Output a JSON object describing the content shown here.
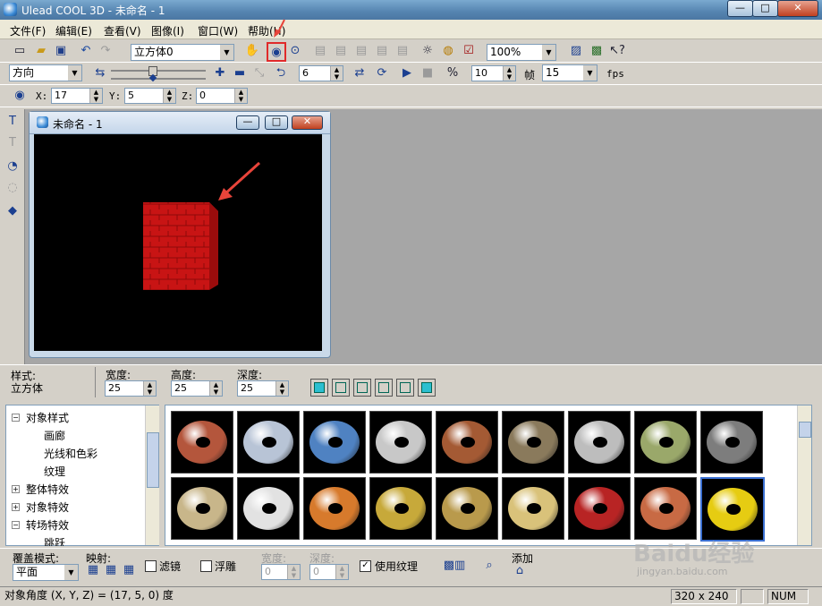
{
  "window": {
    "title": "Ulead COOL 3D - 未命名 - 1",
    "min": "—",
    "max": "□",
    "close": "✕"
  },
  "menu": [
    "文件(F)",
    "编辑(E)",
    "查看(V)",
    "图像(I)",
    "窗口(W)",
    "帮助(H)"
  ],
  "toolbar1": {
    "object_select": "立方体0",
    "zoom": "100%"
  },
  "toolbar2": {
    "motion": "方向",
    "frame_val": "6",
    "speed": "10",
    "frames_label": "帧",
    "frames": "15",
    "fps_label": "fps"
  },
  "coords": {
    "x_label": "X:",
    "x": "17",
    "y_label": "Y:",
    "y": "5",
    "z_label": "Z:",
    "z": "0"
  },
  "document": {
    "title": "未命名 - 1"
  },
  "props": {
    "style_label": "样式:",
    "style_value": "立方体",
    "width_label": "宽度:",
    "width": "25",
    "height_label": "高度:",
    "height": "25",
    "depth_label": "深度:",
    "depth": "25"
  },
  "tree": [
    {
      "label": "对象样式",
      "expander": "⊟"
    },
    {
      "label": "画廊"
    },
    {
      "label": "光线和色彩"
    },
    {
      "label": "纹理"
    },
    {
      "label": "整体特效",
      "expander": "⊞"
    },
    {
      "label": "对象特效",
      "expander": "⊞"
    },
    {
      "label": "转场特效",
      "expander": "⊟"
    },
    {
      "label": "跳跃"
    }
  ],
  "textures": [
    {
      "name": "brick",
      "color": "#b4563c"
    },
    {
      "name": "blue-silver",
      "color": "#b8c4d6"
    },
    {
      "name": "blue-stone",
      "color": "#4f82c2"
    },
    {
      "name": "white-brick",
      "color": "#c8c8c8"
    },
    {
      "name": "copper-brick",
      "color": "#a45a34"
    },
    {
      "name": "stone",
      "color": "#8a7a5c"
    },
    {
      "name": "marble",
      "color": "#bdbdbd"
    },
    {
      "name": "moss",
      "color": "#9aa86a"
    },
    {
      "name": "granite",
      "color": "#7d7d7d"
    },
    {
      "name": "burlap",
      "color": "#c8b68a"
    },
    {
      "name": "chrome",
      "color": "#e2e2e2"
    },
    {
      "name": "orange",
      "color": "#d77a2c"
    },
    {
      "name": "gold",
      "color": "#c7a93a"
    },
    {
      "name": "brass",
      "color": "#b99a4c"
    },
    {
      "name": "gold-chrome",
      "color": "#d9c27a"
    },
    {
      "name": "red-brick",
      "color": "#b82424"
    },
    {
      "name": "terracotta",
      "color": "#c86a44"
    },
    {
      "name": "yellow",
      "color": "#e6cc12"
    }
  ],
  "bottom": {
    "cover_label": "覆盖模式:",
    "cover_value": "平面",
    "map_label": "映射:",
    "filter_label": "滤镜",
    "emboss_label": "浮雕",
    "width_label": "宽度:",
    "width_value": "0",
    "depth_label": "深度:",
    "depth_value": "0",
    "use_texture_label": "使用纹理",
    "add_label": "添加"
  },
  "status": {
    "text": "对象角度 (X, Y, Z) = (17, 5, 0) 度",
    "size": "320 x 240",
    "num": "NUM"
  },
  "watermark": {
    "site": "Baidu经验",
    "url": "jingyan.baidu.com"
  },
  "colors": {
    "cube": "#c81414",
    "highlight": "#e03030",
    "arrow": "#e8443a"
  }
}
